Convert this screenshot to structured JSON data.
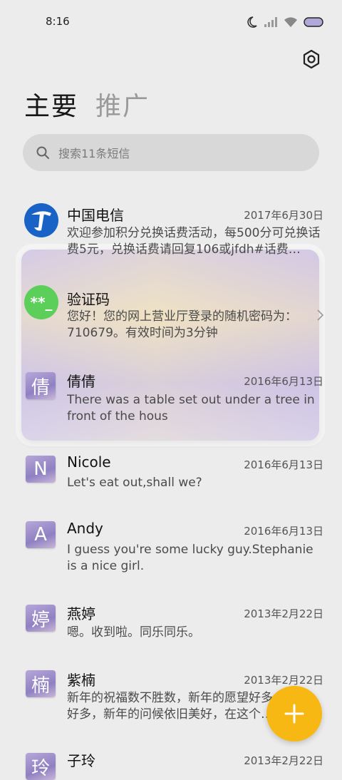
{
  "status_bar": {
    "time": "8:16"
  },
  "tabs": [
    {
      "label": "主要"
    },
    {
      "label": "推广"
    }
  ],
  "search": {
    "placeholder": "搜索11条短信"
  },
  "messages": [
    {
      "name": "中国电信",
      "date": "2017年6月30日",
      "preview": "欢迎参加积分兑换话费活动，每500分可兑换话费5元，兑换话费请回复106或jfdh#话费…",
      "avatar": "china-telecom-logo"
    },
    {
      "name": "验证码",
      "date": "",
      "preview": "您好！您的网上营业厅登录的随机密码为：710679。有效时间为3分钟",
      "avatar_text": "**_"
    },
    {
      "name": "倩倩",
      "date": "2016年6月13日",
      "preview": "There was a table set out under a tree in front of the hous",
      "avatar_text": "倩"
    },
    {
      "name": "Nicole",
      "date": "2016年6月13日",
      "preview": "Let's eat out,shall we?",
      "avatar_text": "N"
    },
    {
      "name": "Andy",
      "date": "2016年6月13日",
      "preview": "I guess you're some lucky guy.Stephanie is a nice girl.",
      "avatar_text": "A"
    },
    {
      "name": "燕婷",
      "date": "2013年2月22日",
      "preview": "嗯。收到啦。同乐同乐。",
      "avatar_text": "婷"
    },
    {
      "name": "紫楠",
      "date": "2013年2月22日",
      "preview": "新年的祝福数不胜数，新年的愿望好多好多，新年的问候依旧美好，在这个温馨的",
      "avatar_text": "楠"
    },
    {
      "name": "子玲",
      "date": "2013年2月22日",
      "preview": "",
      "avatar_text": "玲"
    }
  ],
  "colors": {
    "accent_fab": "#f8b814",
    "telecom_blue": "#1a63c6",
    "verify_green": "#5ccf5a"
  },
  "icons": [
    "moon-icon",
    "signal-icon",
    "wifi-icon",
    "battery-icon",
    "settings-icon",
    "search-icon",
    "chevron-right-icon",
    "add-icon"
  ]
}
